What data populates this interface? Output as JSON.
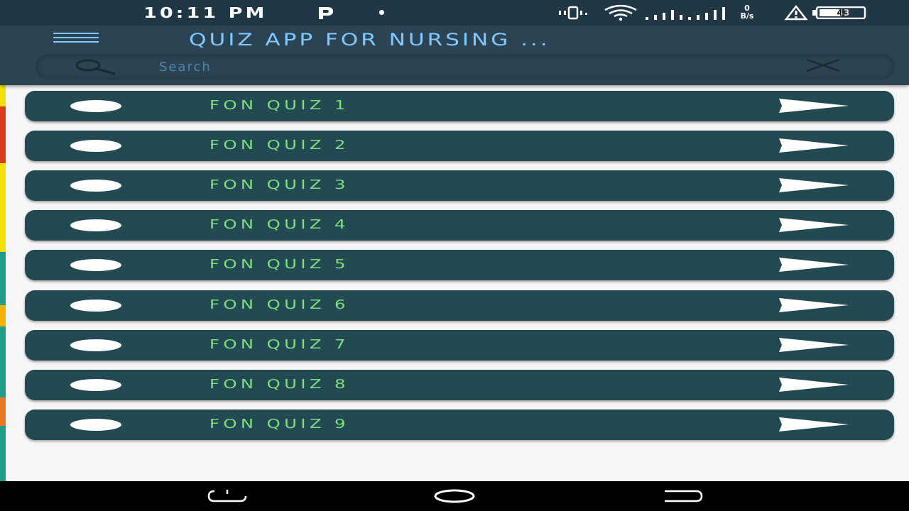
{
  "status_bar": {
    "time": "10:11 PM",
    "net_speed_value": "0",
    "net_speed_unit": "B/s",
    "battery": "43",
    "icons": [
      "parking-icon",
      "notification-dot-icon",
      "vibrate-icon",
      "wifi-icon",
      "signal-icon",
      "signal-icon",
      "alert-icon",
      "battery-icon"
    ]
  },
  "appbar": {
    "title": "QUIZ APP FOR NURSING ...",
    "search_placeholder": "Search",
    "menu_icon": "hamburger-menu-icon",
    "search_icon": "search-icon",
    "clear_icon": "close-icon"
  },
  "quizzes": [
    {
      "label": "FON QUIZ 1"
    },
    {
      "label": "FON QUIZ 2"
    },
    {
      "label": "FON QUIZ 3"
    },
    {
      "label": "FON QUIZ 4"
    },
    {
      "label": "FON QUIZ 5"
    },
    {
      "label": "FON QUIZ 6"
    },
    {
      "label": "FON QUIZ 7"
    },
    {
      "label": "FON QUIZ 8"
    },
    {
      "label": "FON QUIZ 9"
    }
  ],
  "colors": {
    "status_bar": "#203746",
    "app_bar": "#2b4353",
    "accent_text": "#7ec9ff",
    "item_bg": "#234a52",
    "item_text": "#7de07d",
    "background": "#f6f6f6"
  },
  "nav_bar": {
    "icons": [
      "recents-icon",
      "home-icon",
      "back-icon"
    ]
  }
}
